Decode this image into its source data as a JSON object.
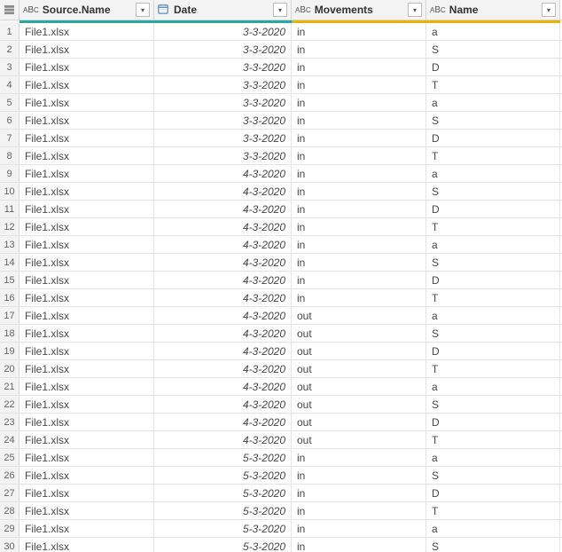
{
  "columns": [
    {
      "key": "source",
      "label": "Source.Name",
      "type": "text",
      "accent": "#2aa89f"
    },
    {
      "key": "date",
      "label": "Date",
      "type": "date",
      "accent": "#2aa89f"
    },
    {
      "key": "mov",
      "label": "Movements",
      "type": "text",
      "accent": "#e8b400"
    },
    {
      "key": "name",
      "label": "Name",
      "type": "text",
      "accent": "#e8b400"
    }
  ],
  "rows": [
    {
      "idx": 1,
      "source": "File1.xlsx",
      "date": "3-3-2020",
      "mov": "in",
      "name": "a"
    },
    {
      "idx": 2,
      "source": "File1.xlsx",
      "date": "3-3-2020",
      "mov": "in",
      "name": "S"
    },
    {
      "idx": 3,
      "source": "File1.xlsx",
      "date": "3-3-2020",
      "mov": "in",
      "name": "D"
    },
    {
      "idx": 4,
      "source": "File1.xlsx",
      "date": "3-3-2020",
      "mov": "in",
      "name": "T"
    },
    {
      "idx": 5,
      "source": "File1.xlsx",
      "date": "3-3-2020",
      "mov": "in",
      "name": "a"
    },
    {
      "idx": 6,
      "source": "File1.xlsx",
      "date": "3-3-2020",
      "mov": "in",
      "name": "S"
    },
    {
      "idx": 7,
      "source": "File1.xlsx",
      "date": "3-3-2020",
      "mov": "in",
      "name": "D"
    },
    {
      "idx": 8,
      "source": "File1.xlsx",
      "date": "3-3-2020",
      "mov": "in",
      "name": "T"
    },
    {
      "idx": 9,
      "source": "File1.xlsx",
      "date": "4-3-2020",
      "mov": "in",
      "name": "a"
    },
    {
      "idx": 10,
      "source": "File1.xlsx",
      "date": "4-3-2020",
      "mov": "in",
      "name": "S"
    },
    {
      "idx": 11,
      "source": "File1.xlsx",
      "date": "4-3-2020",
      "mov": "in",
      "name": "D"
    },
    {
      "idx": 12,
      "source": "File1.xlsx",
      "date": "4-3-2020",
      "mov": "in",
      "name": "T"
    },
    {
      "idx": 13,
      "source": "File1.xlsx",
      "date": "4-3-2020",
      "mov": "in",
      "name": "a"
    },
    {
      "idx": 14,
      "source": "File1.xlsx",
      "date": "4-3-2020",
      "mov": "in",
      "name": "S"
    },
    {
      "idx": 15,
      "source": "File1.xlsx",
      "date": "4-3-2020",
      "mov": "in",
      "name": "D"
    },
    {
      "idx": 16,
      "source": "File1.xlsx",
      "date": "4-3-2020",
      "mov": "in",
      "name": "T"
    },
    {
      "idx": 17,
      "source": "File1.xlsx",
      "date": "4-3-2020",
      "mov": "out",
      "name": "a"
    },
    {
      "idx": 18,
      "source": "File1.xlsx",
      "date": "4-3-2020",
      "mov": "out",
      "name": "S"
    },
    {
      "idx": 19,
      "source": "File1.xlsx",
      "date": "4-3-2020",
      "mov": "out",
      "name": "D"
    },
    {
      "idx": 20,
      "source": "File1.xlsx",
      "date": "4-3-2020",
      "mov": "out",
      "name": "T"
    },
    {
      "idx": 21,
      "source": "File1.xlsx",
      "date": "4-3-2020",
      "mov": "out",
      "name": "a"
    },
    {
      "idx": 22,
      "source": "File1.xlsx",
      "date": "4-3-2020",
      "mov": "out",
      "name": "S"
    },
    {
      "idx": 23,
      "source": "File1.xlsx",
      "date": "4-3-2020",
      "mov": "out",
      "name": "D"
    },
    {
      "idx": 24,
      "source": "File1.xlsx",
      "date": "4-3-2020",
      "mov": "out",
      "name": "T"
    },
    {
      "idx": 25,
      "source": "File1.xlsx",
      "date": "5-3-2020",
      "mov": "in",
      "name": "a"
    },
    {
      "idx": 26,
      "source": "File1.xlsx",
      "date": "5-3-2020",
      "mov": "in",
      "name": "S"
    },
    {
      "idx": 27,
      "source": "File1.xlsx",
      "date": "5-3-2020",
      "mov": "in",
      "name": "D"
    },
    {
      "idx": 28,
      "source": "File1.xlsx",
      "date": "5-3-2020",
      "mov": "in",
      "name": "T"
    },
    {
      "idx": 29,
      "source": "File1.xlsx",
      "date": "5-3-2020",
      "mov": "in",
      "name": "a"
    },
    {
      "idx": 30,
      "source": "File1.xlsx",
      "date": "5-3-2020",
      "mov": "in",
      "name": "S"
    }
  ]
}
